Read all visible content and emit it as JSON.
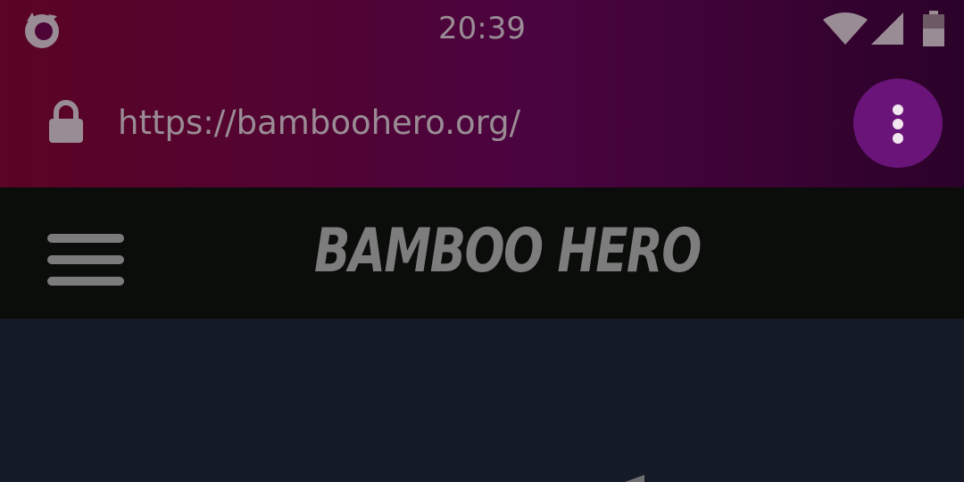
{
  "status_bar": {
    "time": "20:39",
    "app_icon": "firefox-icon",
    "wifi_icon": "wifi-icon",
    "signal_icon": "cell-signal-icon",
    "battery_icon": "battery-icon"
  },
  "browser": {
    "url": "https://bamboohero.org/",
    "lock_icon": "lock-icon",
    "menu_icon": "overflow-menu-icon",
    "menu_button_color": "#6a1479"
  },
  "site": {
    "logo_text": "BAMBOO HERO",
    "menu_icon": "hamburger-icon"
  },
  "colors": {
    "toolbar_gradient_start": "#5b0424",
    "toolbar_gradient_end": "#2a0229",
    "header_bg": "#0b0d0b",
    "content_bg": "#151b26",
    "muted_text": "#9a8c95"
  }
}
